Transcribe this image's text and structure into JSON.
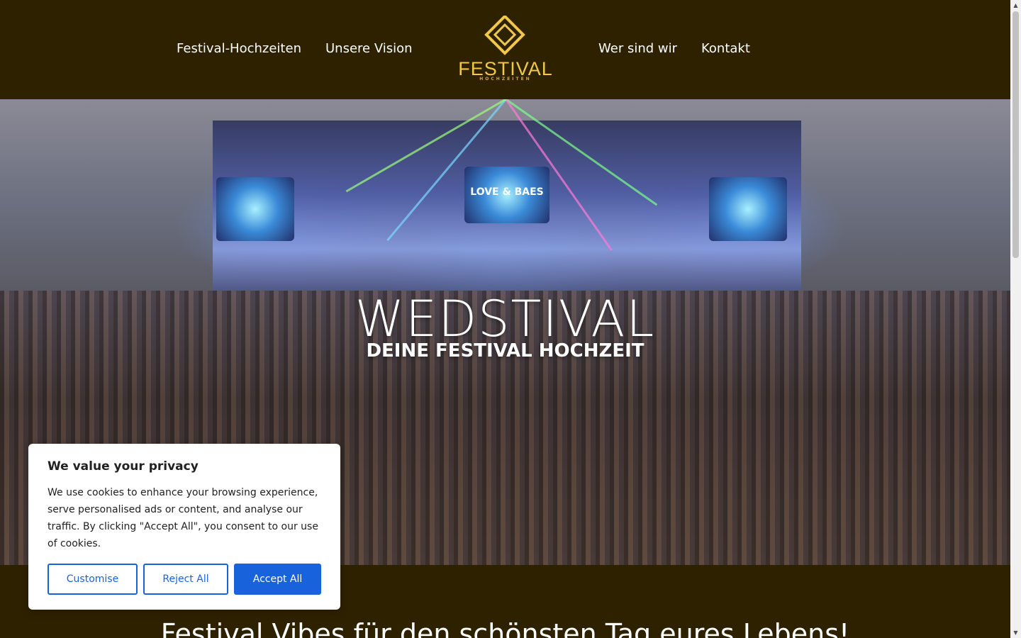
{
  "nav": {
    "left": [
      "Festival-Hochzeiten",
      "Unsere Vision"
    ],
    "right": [
      "Wer sind wir",
      "Kontakt"
    ]
  },
  "logo": {
    "word": "FESTIVAL",
    "sub": "HOCHZEITEN",
    "color": "#f0c84b"
  },
  "hero": {
    "title": "WEDSTIVAL",
    "subtitle": "DEINE FESTIVAL HOCHZEIT",
    "stage_sign": "LOVE & BAES"
  },
  "section": {
    "heading": "Festival Vibes für den schönsten Tag eures Lebens!"
  },
  "cookie": {
    "title": "We value your privacy",
    "text": "We use cookies to enhance your browsing experience, serve personalised ads or content, and analyse our traffic. By clicking \"Accept All\", you consent to our use of cookies.",
    "customise": "Customise",
    "reject": "Reject All",
    "accept": "Accept All",
    "accent": "#1863dc"
  },
  "colors": {
    "background": "#2e2100",
    "text": "#ffffff"
  }
}
